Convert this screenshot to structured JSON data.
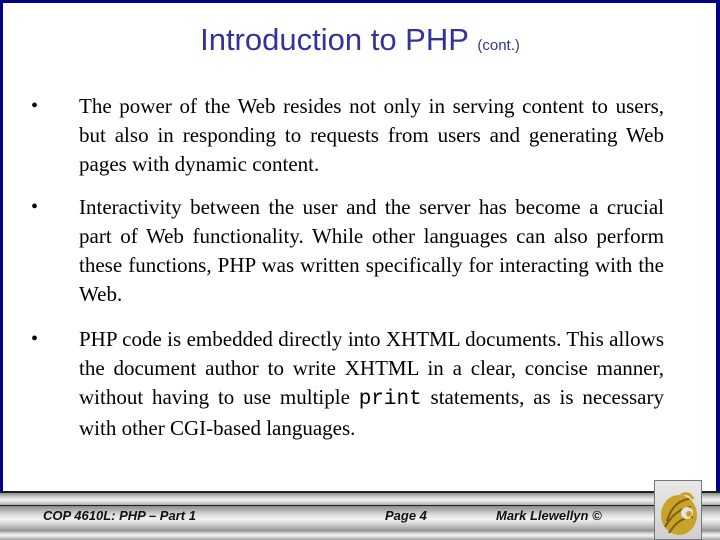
{
  "slide": {
    "title": "Introduction to PHP",
    "title_suffix": "(cont.)",
    "colors": {
      "border": "#00008b",
      "title": "#33339a",
      "logo_gold": "#c9a227"
    },
    "bullets": [
      {
        "marker": "•",
        "text": "The power of the Web resides not only in serving content to users, but also in responding to requests from users and generating Web pages with dynamic content."
      },
      {
        "marker": "•",
        "text": "Interactivity between the user and the server has become a crucial part of Web functionality.  While other languages can also perform these functions, PHP was written specifically for interacting with the Web."
      },
      {
        "marker": "•",
        "text_before_code": "PHP code is embedded directly into XHTML documents.  This allows the document author to write XHTML in a clear, concise manner, without having to use multiple ",
        "code": "print",
        "text_after_code": " statements, as is necessary with other CGI-based languages."
      }
    ]
  },
  "footer": {
    "course": "COP 4610L:  PHP – Part 1",
    "page": "Page 4",
    "author": "Mark Llewellyn ©",
    "logo_icon": "pegasus-logo-icon"
  }
}
